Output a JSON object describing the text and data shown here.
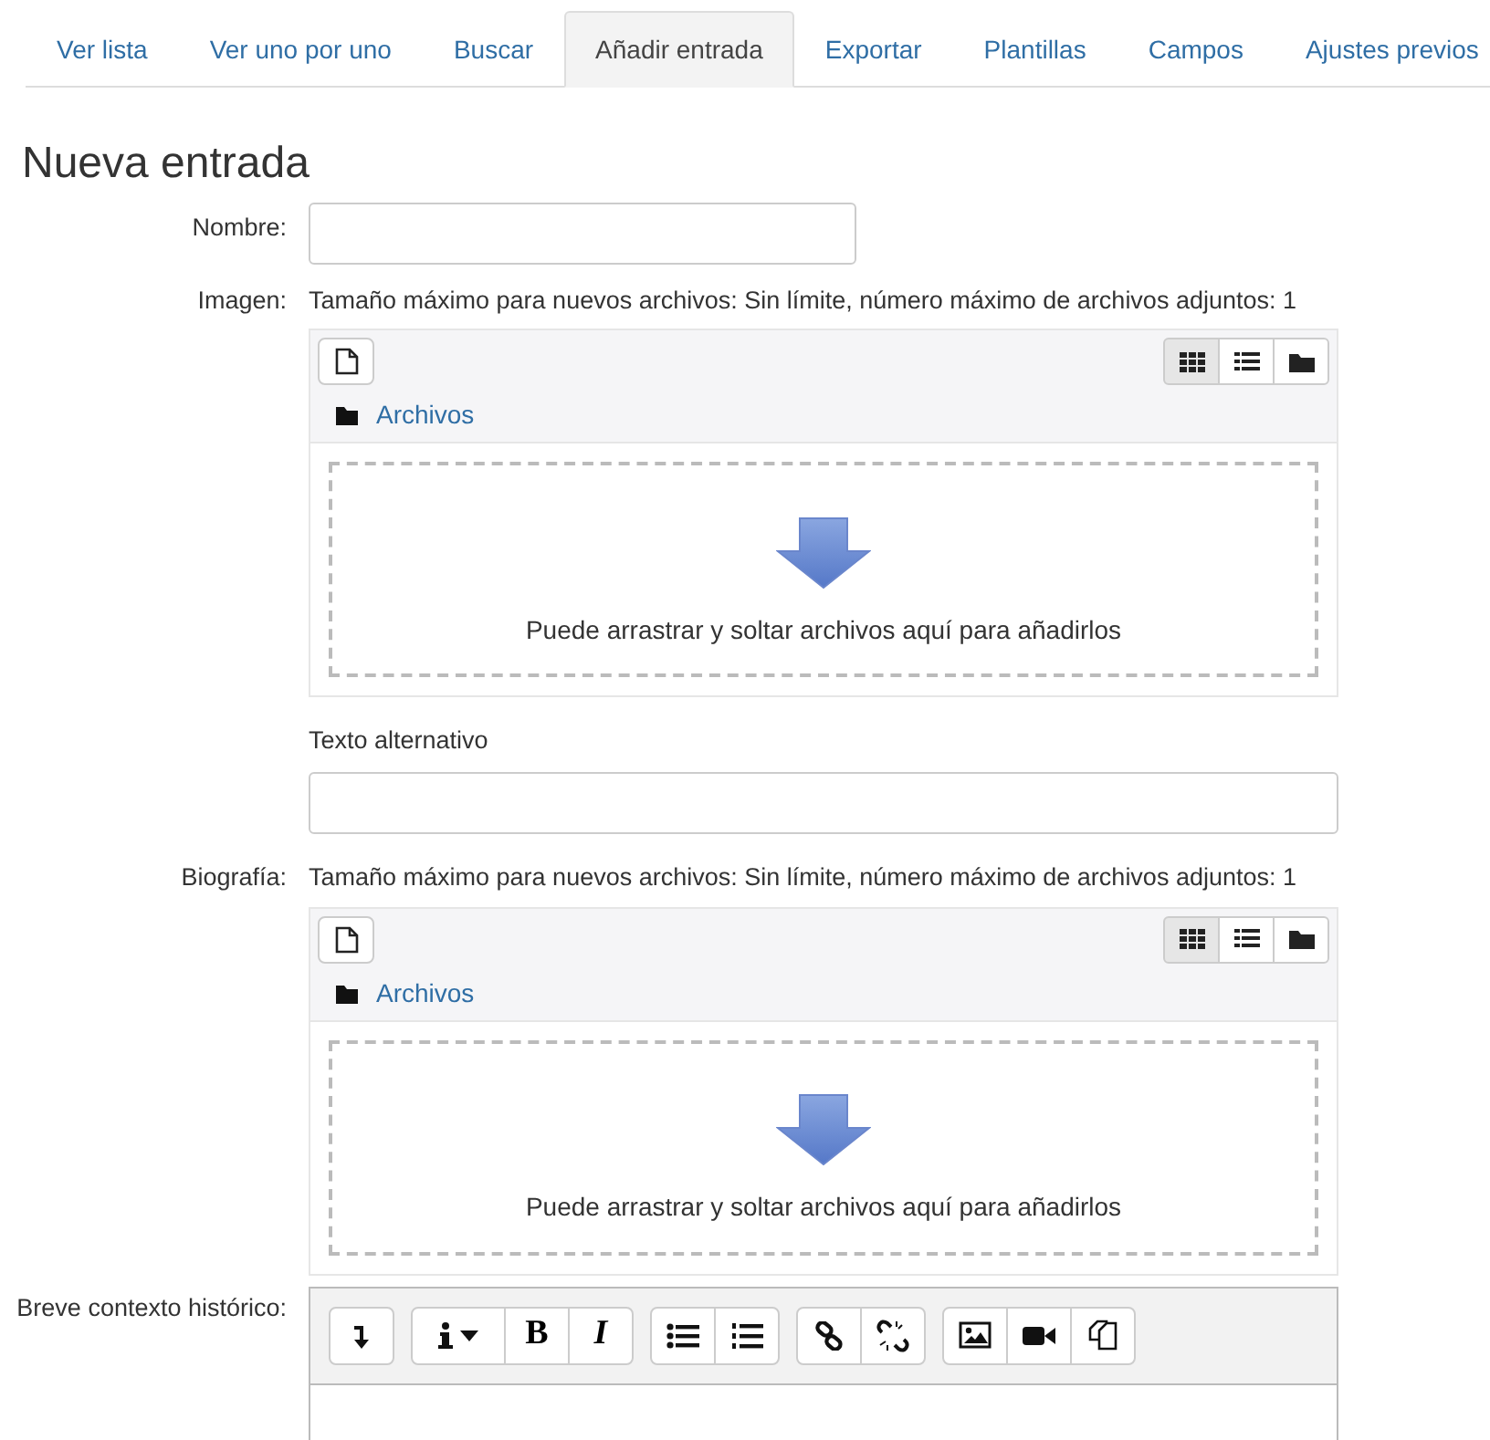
{
  "tabs": [
    {
      "label": "Ver lista",
      "selected": false
    },
    {
      "label": "Ver uno por uno",
      "selected": false
    },
    {
      "label": "Buscar",
      "selected": false
    },
    {
      "label": "Añadir entrada",
      "selected": true
    },
    {
      "label": "Exportar",
      "selected": false
    },
    {
      "label": "Plantillas",
      "selected": false
    },
    {
      "label": "Campos",
      "selected": false
    },
    {
      "label": "Ajustes previos",
      "selected": false
    }
  ],
  "heading": "Nueva entrada",
  "fields": [
    {
      "kind": "text",
      "label": "Nombre:"
    },
    {
      "kind": "file",
      "label": "Imagen:",
      "limits": "Tamaño máximo para nuevos archivos: Sin límite, número máximo de archivos adjuntos: 1",
      "folder": "Archivos",
      "views": [
        {
          "kind": "grid",
          "selected": true
        },
        {
          "kind": "list",
          "selected": false
        },
        {
          "kind": "tree",
          "selected": false
        }
      ],
      "drop_hint": "Puede arrastrar y soltar archivos aquí para añadirlos",
      "alt_label": "Texto alternativo"
    },
    {
      "kind": "file",
      "label": "Biografía:",
      "limits": "Tamaño máximo para nuevos archivos: Sin límite, número máximo de archivos adjuntos: 1",
      "folder": "Archivos",
      "views": [
        {
          "kind": "grid",
          "selected": true
        },
        {
          "kind": "list",
          "selected": false
        },
        {
          "kind": "tree",
          "selected": false
        }
      ],
      "drop_hint": "Puede arrastrar y soltar archivos aquí para añadirlos"
    },
    {
      "kind": "editor",
      "label": "Breve contexto histórico:",
      "toolbar_groups": [
        [
          {
            "kind": "collapse"
          }
        ],
        [
          {
            "kind": "info"
          },
          {
            "kind": "bold",
            "label": "B"
          },
          {
            "kind": "italic",
            "label": "I"
          }
        ],
        [
          {
            "kind": "bullets"
          },
          {
            "kind": "numbers"
          }
        ],
        [
          {
            "kind": "link"
          },
          {
            "kind": "unlink"
          }
        ],
        [
          {
            "kind": "image"
          },
          {
            "kind": "video"
          },
          {
            "kind": "copy"
          }
        ]
      ]
    }
  ]
}
